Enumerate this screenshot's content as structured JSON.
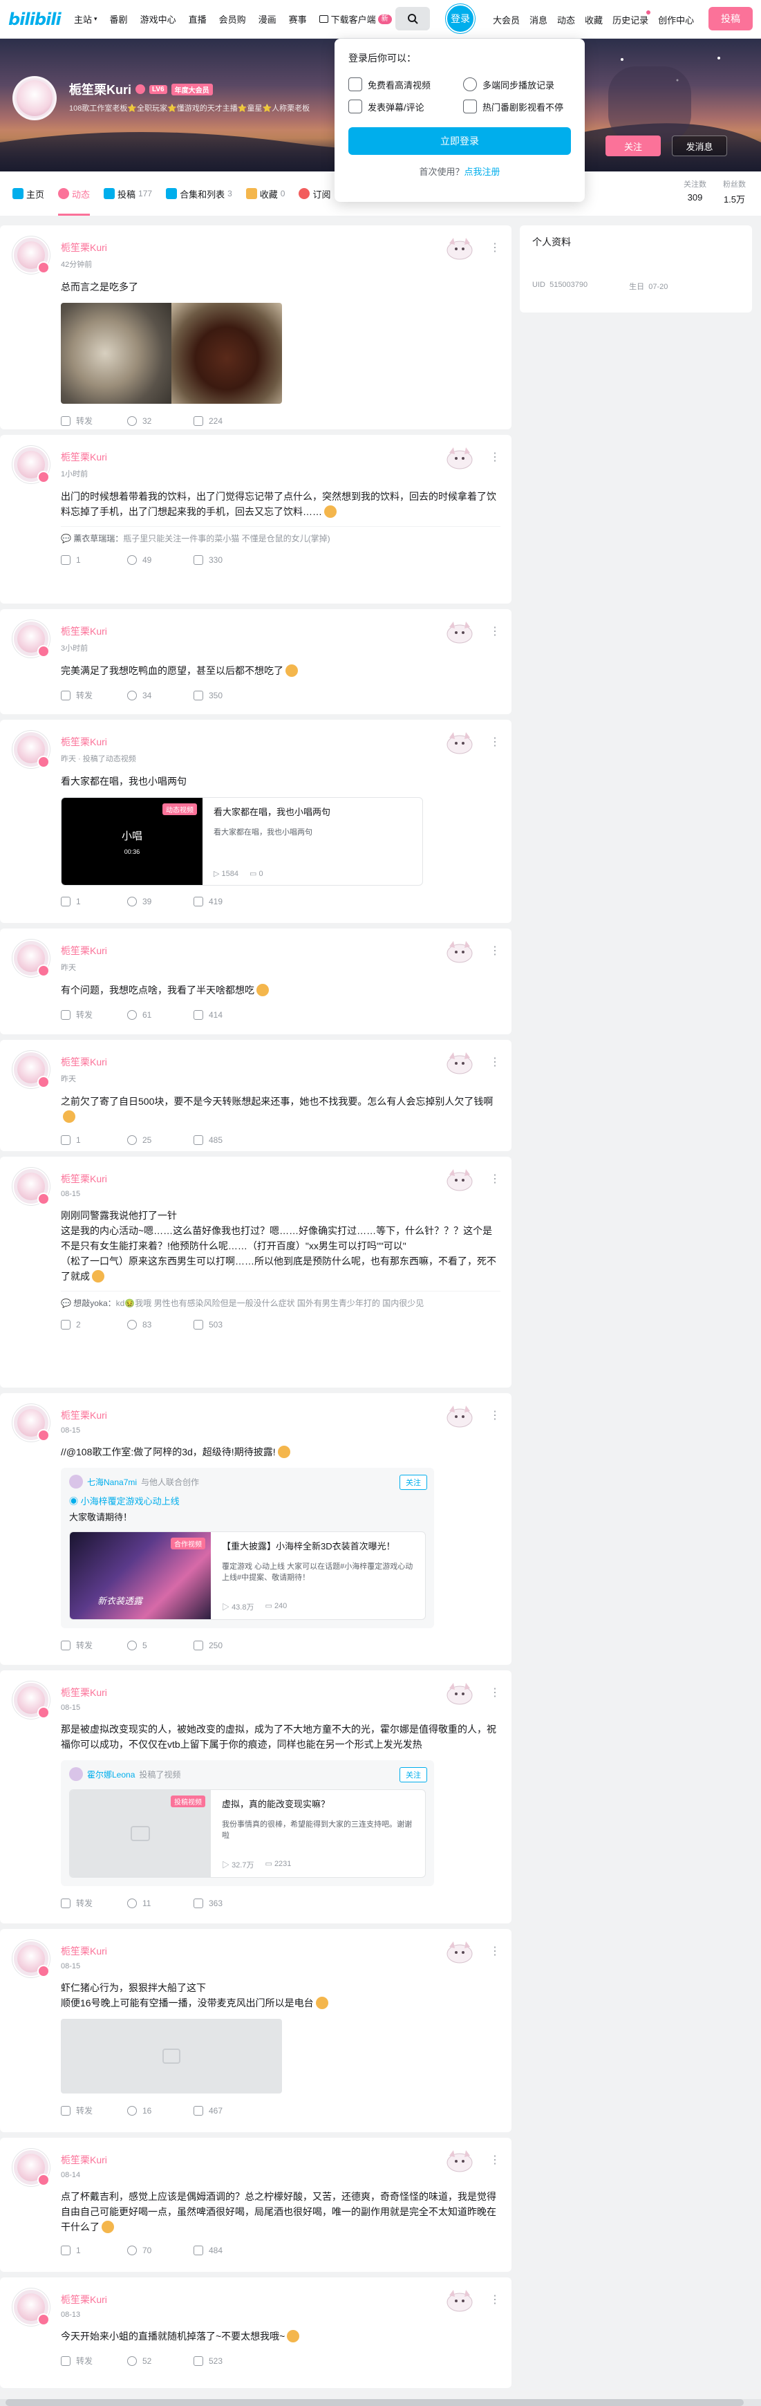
{
  "topnav": {
    "home": "主站",
    "items": [
      "番剧",
      "游戏中心",
      "直播",
      "会员购",
      "漫画",
      "赛事"
    ],
    "download": "下载客户端",
    "download_badge": "新",
    "login": "登录",
    "right": [
      "大会员",
      "消息",
      "动态",
      "收藏",
      "历史记录",
      "创作中心"
    ],
    "upload": "投稿"
  },
  "login_popup": {
    "title": "登录后你可以：",
    "benefits": [
      "免费看高清视频",
      "多端同步播放记录",
      "发表弹幕/评论",
      "热门番剧影视看不停"
    ],
    "button": "立即登录",
    "register_prefix": "首次使用？",
    "register_link": "点我注册"
  },
  "profile": {
    "name": "栀笙栗Kuri",
    "level": "LV6",
    "vip": "年度大会员",
    "sign": "108歌工作室老板⭐全职玩家⭐懂游戏的天才主播⭐童星⭐人称栗老板",
    "follow": "关注",
    "message": "发消息",
    "colors": {
      "accent": "#fb7299",
      "blue": "#00aeec"
    }
  },
  "tabs": [
    {
      "label": "主页",
      "count": "",
      "icon": "home-icon"
    },
    {
      "label": "动态",
      "count": "",
      "icon": "dynamic-icon"
    },
    {
      "label": "投稿",
      "count": "177",
      "icon": "video-icon"
    },
    {
      "label": "合集和列表",
      "count": "3",
      "icon": "collection-icon"
    },
    {
      "label": "收藏",
      "count": "0",
      "icon": "star-icon"
    },
    {
      "label": "订阅",
      "count": "",
      "icon": "heart-icon"
    }
  ],
  "stats": [
    {
      "label": "关注数",
      "value": "309"
    },
    {
      "label": "粉丝数",
      "value": "1.5万"
    }
  ],
  "sidebar": {
    "title": "个人资料",
    "uid_label": "UID",
    "uid": "515003790",
    "birthday_label": "生日",
    "birthday": "07-20"
  },
  "feed": [
    {
      "name": "栀笙栗Kuri",
      "time": "42分钟前",
      "text": "总而言之是吃多了",
      "type": "images",
      "repost": "转发",
      "comments": "32",
      "likes": "224"
    },
    {
      "name": "栀笙栗Kuri",
      "time": "1小时前",
      "text": "出门的时候想着带着我的饮料，出了门觉得忘记带了点什么，突然想到我的饮料，回去的时候拿着了饮料忘掉了手机，出了门想起来我的手机，回去又忘了饮料……",
      "emoji": true,
      "comment_user": "薰衣草瑞瑞：",
      "comment_text": "瓶子里只能关注一件事的菜小猫 不懂是仓鼠的女儿(掌掉)",
      "repost": "1",
      "comments": "49",
      "likes": "330"
    },
    {
      "name": "栀笙栗Kuri",
      "time": "3小时前",
      "text": "完美满足了我想吃鸭血的愿望，甚至以后都不想吃了",
      "emoji": true,
      "repost": "转发",
      "comments": "34",
      "likes": "350"
    },
    {
      "name": "栀笙栗Kuri",
      "time": "昨天 · 投稿了动态视频",
      "text": "看大家都在唱，我也小唱两句",
      "type": "video",
      "video": {
        "tag": "动态视频",
        "cover_title": "小唱",
        "duration": "00:36",
        "title": "看大家都在唱，我也小唱两句",
        "desc": "看大家都在唱，我也小唱两句",
        "views": "1584",
        "danmaku": "0"
      },
      "repost": "1",
      "comments": "39",
      "likes": "419"
    },
    {
      "name": "栀笙栗Kuri",
      "time": "昨天",
      "text": "有个问题，我想吃点啥，我看了半天啥都想吃",
      "emoji": true,
      "repost": "转发",
      "comments": "61",
      "likes": "414"
    },
    {
      "name": "栀笙栗Kuri",
      "time": "昨天",
      "text": "之前欠了寄了自日500块，要不是今天转账想起来还事，她也不找我要。怎么有人会忘掉别人欠了钱啊",
      "emoji": true,
      "repost": "1",
      "comments": "25",
      "likes": "485"
    },
    {
      "name": "栀笙栗Kuri",
      "time": "08-15",
      "text": "刚刚同警露我说他打了一针\n这是我的内心活动~嗯……这么苗好像我也打过？嗯……好像确实打过……等下，什么针？？？这个是不是只有女生能打来着？!他预防什么呢……（打开百度）\"xx男生可以打吗\"\"可以\"\n（松了一口气）原来这东西男生可以打啊……所以他到底是预防什么呢，也有那东西嘛，不看了，死不了就成",
      "emoji": true,
      "comment_user": "想敲yoka：",
      "comment_text": "kd🤢我哦 男性也有感染风险但是一般没什么症状 国外有男生青少年打的 国内很少见",
      "repost": "2",
      "comments": "83",
      "likes": "503"
    },
    {
      "name": "栀笙栗Kuri",
      "time": "08-15",
      "text": "//@108歌工作室:做了阿梓的3d，超级待!期待披露!",
      "emoji": true,
      "type": "repost_video",
      "repost_data": {
        "user": "七海Nana7mi",
        "user_tag": "与他人联合创作",
        "follow": "关注",
        "topic": "小海梓覆定游戏心动上线",
        "text": "大家敬请期待！",
        "video": {
          "tag": "合作视频",
          "cover_title": "新衣装透露",
          "title": "【重大披露】小海梓全新3D衣装首次曝光！",
          "desc": "覆定游戏 心动上线 大家可以在话题#小海梓覆定游戏心动上线#中提案、敬请期待！",
          "views": "43.8万",
          "danmaku": "240"
        }
      },
      "repost": "转发",
      "comments": "5",
      "likes": "250"
    },
    {
      "name": "栀笙栗Kuri",
      "time": "08-15",
      "text": "那是被虚拟改变现实的人，被她改变的虚拟，成为了不大地方童不大的光，霍尔娜是值得敬重的人，祝福你可以成功，不仅仅在vtb上留下属于你的痕迹，同样也能在另一个形式上发光发热",
      "type": "repost_video",
      "repost_data": {
        "user": "霍尔娜Leona",
        "user_tag": "投稿了视频",
        "follow": "关注",
        "topic": "",
        "text": "",
        "video": {
          "tag": "投稿视频",
          "cover_title": "",
          "title": "虚拟，真的能改变现实嘛？",
          "desc": "我份事情真的很棒，希望能得到大家的三连支持吧。谢谢啦",
          "views": "32.7万",
          "danmaku": "2231"
        }
      },
      "repost": "转发",
      "comments": "11",
      "likes": "363"
    },
    {
      "name": "栀笙栗Kuri",
      "time": "08-15",
      "text": "虾仁猪心行为，狠狠拌大船了这下\n顺便16号晚上可能有空播一播，没带麦克风出门所以是电台",
      "emoji": true,
      "type": "placeholder",
      "repost": "转发",
      "comments": "16",
      "likes": "467"
    },
    {
      "name": "栀笙栗Kuri",
      "time": "08-14",
      "text": "点了杯戴吉利，感觉上应该是偶姆酒调的？总之柠檬好酸，又苦，还德爽，奇奇怪怪的味道，我是觉得自由自己可能更好喝一点，虽然啤酒很好喝，局尾酒也很好喝，唯一的副作用就是完全不太知道昨晚在干什么了",
      "emoji": true,
      "repost": "1",
      "comments": "70",
      "likes": "484"
    },
    {
      "name": "栀笙栗Kuri",
      "time": "08-13",
      "text": "今天开始来小蛆的直播就随机掉落了~不要太想我哦~",
      "emoji": true,
      "repost": "转发",
      "comments": "52",
      "likes": "523"
    }
  ]
}
